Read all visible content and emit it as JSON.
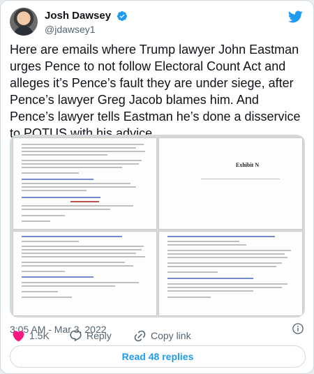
{
  "author": {
    "display_name": "Josh Dawsey",
    "handle": "@jdawsey1",
    "verified": true,
    "avatar_icon": "avatar-photo"
  },
  "tweet": {
    "text": "Here are emails where Trump lawyer John Eastman urges Pence to not follow Electoral Count Act and alleges it’s Pence’s fault they are under siege, after Pence’s lawyer Greg Jacob blames him. And Pence’s lawyer tells Eastman he’s done a disservice to POTUS with his advice.",
    "timestamp": "3:05 AM - Mar 3, 2022"
  },
  "media": {
    "exhibit_label": "Exhibit N",
    "description_icon": "document-scan"
  },
  "actions": {
    "like_count": "1.5K",
    "reply_label": "Reply",
    "copy_label": "Copy link"
  },
  "replies_button": "Read 48 replies",
  "colors": {
    "accent": "#1d9bf0",
    "like_red": "#f91880",
    "muted": "#536471",
    "text": "#0f1419"
  }
}
